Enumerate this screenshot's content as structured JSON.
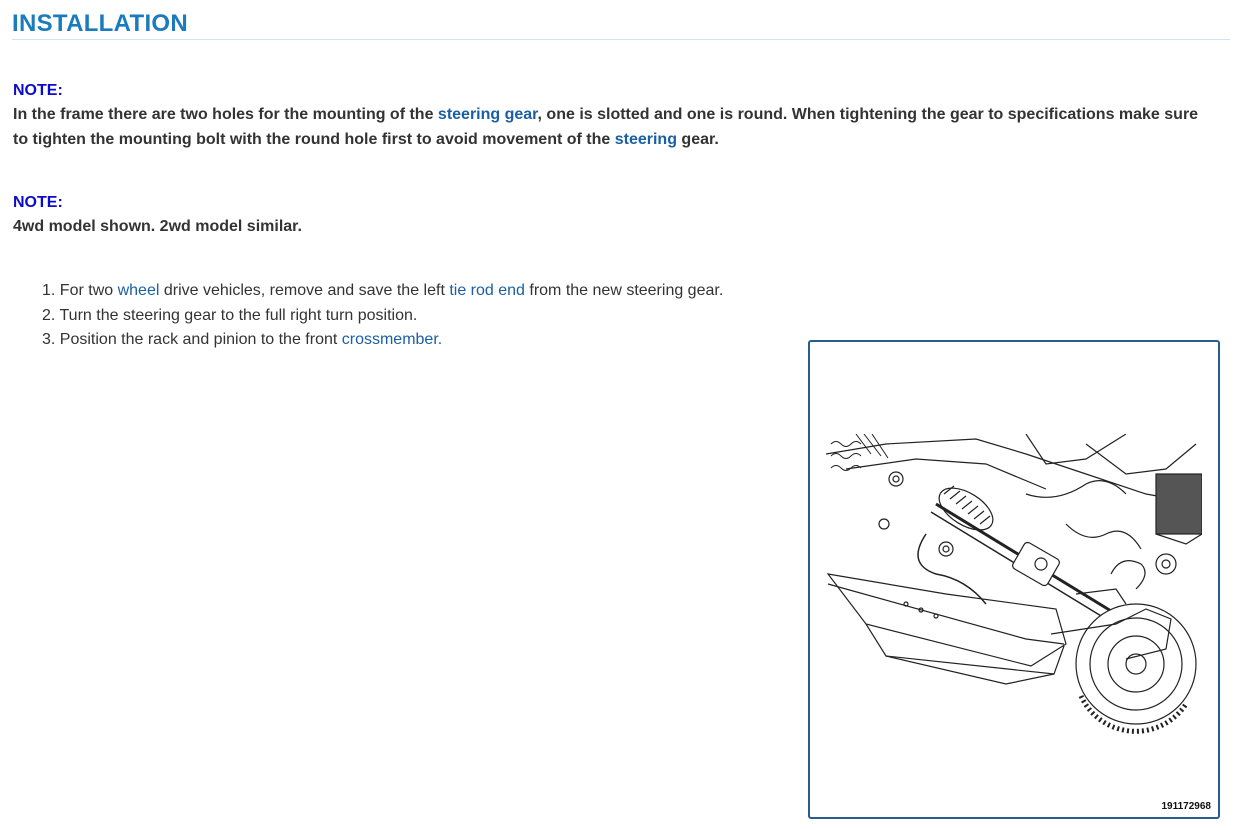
{
  "heading": "INSTALLATION",
  "note1": {
    "label": "NOTE:",
    "text_a": "In the frame there are two holes for the mounting of the ",
    "link_a": "steering gear",
    "text_b": ", one is slotted and one is round. When tightening the gear to specifications make sure to tighten the mounting bolt with the round hole first to avoid movement of the ",
    "link_b": "steering",
    "text_c": " gear."
  },
  "note2": {
    "label": "NOTE:",
    "text": "4wd model shown. 2wd model similar."
  },
  "steps": [
    {
      "num": "1.",
      "pre": "For two ",
      "link1": "wheel",
      "mid": " drive vehicles, remove and save the left ",
      "link2": "tie rod end",
      "post": " from the new steering gear."
    },
    {
      "num": "2.",
      "text": "Turn the steering gear to the full right turn position."
    },
    {
      "num": "3.",
      "pre": "Position the rack and pinion to the front ",
      "link": "crossmember."
    }
  ],
  "figure": {
    "id": "191172968",
    "icon": "steering-gear-illustration"
  }
}
